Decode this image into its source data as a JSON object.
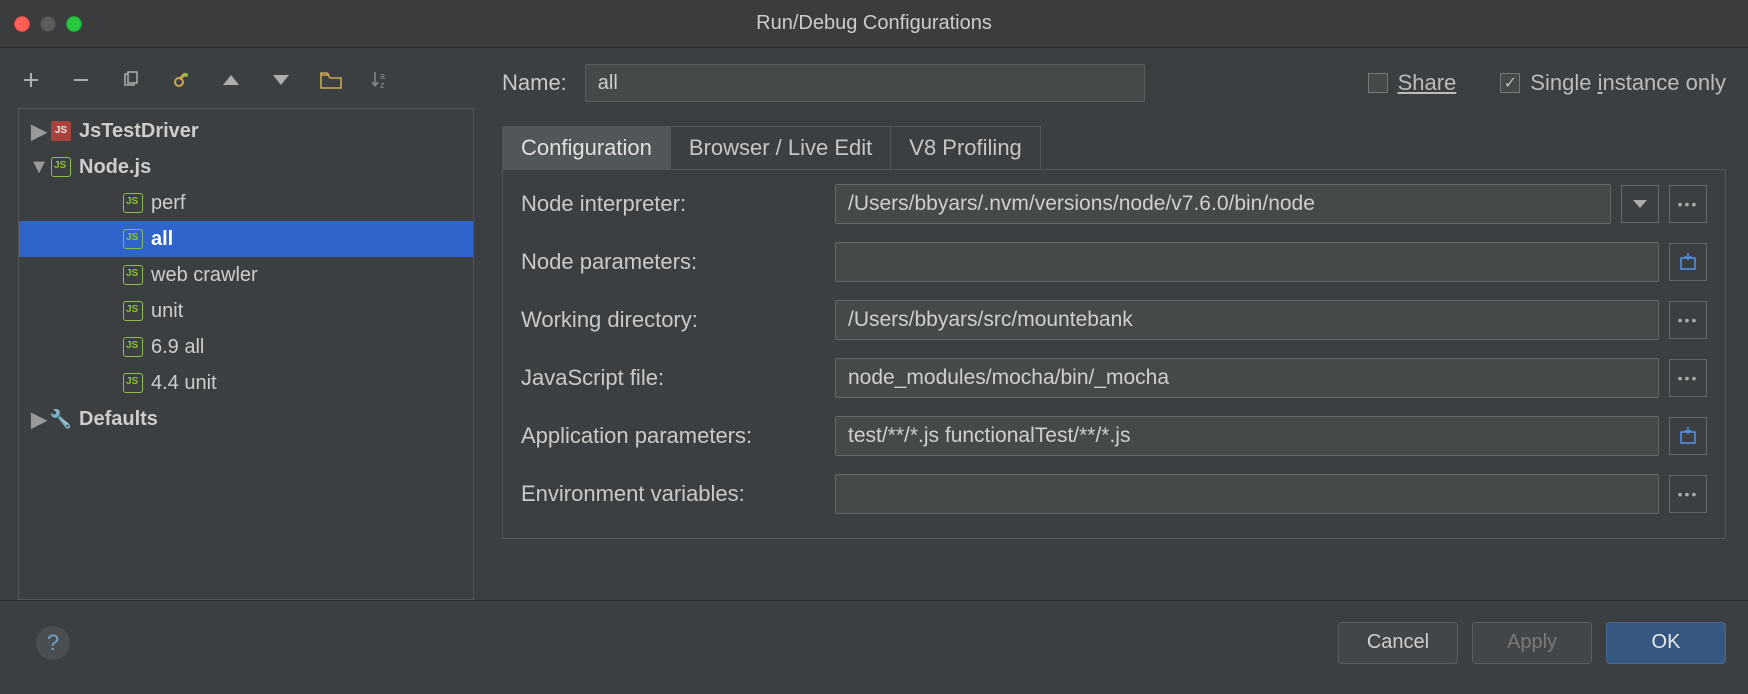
{
  "window": {
    "title": "Run/Debug Configurations"
  },
  "toolbar_icons": [
    "plus",
    "minus",
    "copy",
    "wrench",
    "arrow-up",
    "arrow-down",
    "folder",
    "sort-az"
  ],
  "tree": [
    {
      "label": "JsTestDriver",
      "indent": 0,
      "twisty": "▶",
      "icon": "js",
      "bold": true,
      "selected": false
    },
    {
      "label": "Node.js",
      "indent": 0,
      "twisty": "▼",
      "icon": "node",
      "bold": true,
      "selected": false
    },
    {
      "label": "perf",
      "indent": 2,
      "twisty": "",
      "icon": "node",
      "bold": false,
      "selected": false
    },
    {
      "label": "all",
      "indent": 2,
      "twisty": "",
      "icon": "node",
      "bold": true,
      "selected": true
    },
    {
      "label": "web crawler",
      "indent": 2,
      "twisty": "",
      "icon": "node",
      "bold": false,
      "selected": false
    },
    {
      "label": "unit",
      "indent": 2,
      "twisty": "",
      "icon": "node",
      "bold": false,
      "selected": false
    },
    {
      "label": "6.9 all",
      "indent": 2,
      "twisty": "",
      "icon": "node",
      "bold": false,
      "selected": false
    },
    {
      "label": "4.4 unit",
      "indent": 2,
      "twisty": "",
      "icon": "node",
      "bold": false,
      "selected": false
    },
    {
      "label": "Defaults",
      "indent": 0,
      "twisty": "▶",
      "icon": "wrench",
      "bold": true,
      "selected": false
    }
  ],
  "name_row": {
    "label": "Name:",
    "value": "all",
    "share_label": "Share",
    "share_checked": false,
    "single_label": "Single instance only",
    "single_checked": true
  },
  "tabs": [
    {
      "label": "Configuration",
      "active": true
    },
    {
      "label": "Browser / Live Edit",
      "active": false
    },
    {
      "label": "V8 Profiling",
      "active": false
    }
  ],
  "fields": {
    "node_interpreter": {
      "label": "Node interpreter:",
      "value": "/Users/bbyars/.nvm/versions/node/v7.6.0/bin/node",
      "buttons": [
        "dropdown",
        "ellipsis"
      ]
    },
    "node_parameters": {
      "label": "Node parameters:",
      "value": "",
      "buttons": [
        "expand"
      ]
    },
    "working_directory": {
      "label": "Working directory:",
      "value": "/Users/bbyars/src/mountebank",
      "buttons": [
        "ellipsis"
      ]
    },
    "javascript_file": {
      "label": "JavaScript file:",
      "value": "node_modules/mocha/bin/_mocha",
      "buttons": [
        "ellipsis"
      ]
    },
    "app_parameters": {
      "label": "Application parameters:",
      "value": "test/**/*.js functionalTest/**/*.js",
      "buttons": [
        "expand"
      ]
    },
    "env_vars": {
      "label": "Environment variables:",
      "value": "",
      "buttons": [
        "ellipsis"
      ]
    }
  },
  "footer": {
    "cancel": "Cancel",
    "apply": "Apply",
    "ok": "OK"
  }
}
